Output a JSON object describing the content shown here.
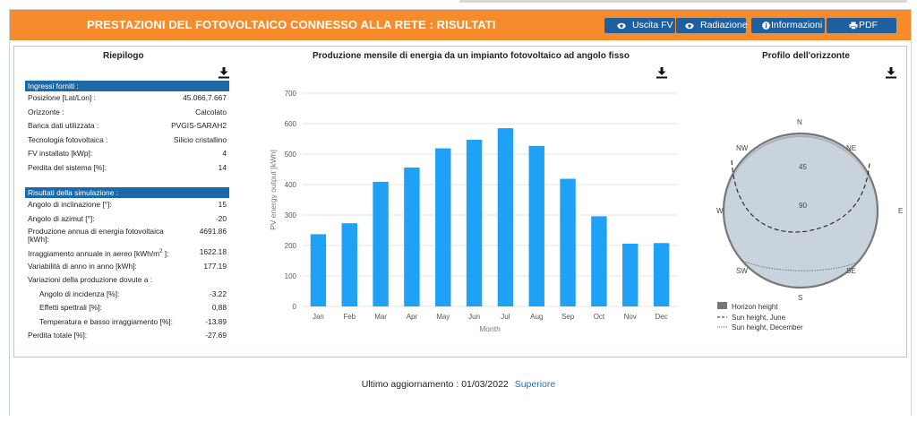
{
  "header": {
    "title": "PRESTAZIONI DEL FOTOVOLTAICO CONNESSO ALLA RETE : RISULTATI",
    "buttons": [
      {
        "label": "Uscita FV",
        "icon": "eye-icon"
      },
      {
        "label": "Radiazione",
        "icon": "eye-icon"
      },
      {
        "label": "Informazioni",
        "icon": "info-icon"
      },
      {
        "label": "PDF",
        "icon": "print-icon"
      }
    ]
  },
  "summary": {
    "title": "Riepilogo",
    "inputs_header": "Ingressi forniti :",
    "inputs": [
      {
        "label": "Posizione [Lat/Lon] :",
        "value": "45.066,7.667"
      },
      {
        "label": "Orizzonte :",
        "value": "Calcolato"
      },
      {
        "label": "Banca dati utilizzata :",
        "value": "PVGIS-SARAH2"
      },
      {
        "label": "Tecnologia fotovoltaica :",
        "value": "Silicio cristallino"
      },
      {
        "label": "FV installato [kWp]:",
        "value": "4"
      },
      {
        "label": "Perdita del sistema [%]:",
        "value": "14"
      }
    ],
    "results_header": "Risultati della simulazione :",
    "results": {
      "tilt": {
        "label": "Angolo di inclinazione [°]:",
        "value": "15"
      },
      "azimuth": {
        "label": "Angolo di azimut [°]:",
        "value": "-20"
      },
      "annual_production": {
        "label": "Produzione annua di energia fotovoltaica [kWh]:",
        "value": "4691.86"
      },
      "irradiation": {
        "label": "Irraggiamento annuale in aereo [kWh/m",
        "sup": "2",
        "label_end": " ]:",
        "value": "1622.18"
      },
      "variability": {
        "label": "Variabilità di anno in anno [kWh]:",
        "value": "177.19"
      },
      "variations_label": "Variazioni della produzione dovute a :",
      "incidence": {
        "label": "Angolo di incidenza [%]:",
        "value": "-3.22"
      },
      "spectral": {
        "label": "Effetti spettrali [%]:",
        "value": "0,88"
      },
      "temperature": {
        "label": "Temperatura e basso irraggiamento [%]:",
        "value": "-13.89"
      },
      "total_loss": {
        "label": "Perdita totale [%]:",
        "value": "-27.69"
      }
    }
  },
  "monthly_chart": {
    "title": "Produzione mensile di energia da un impianto fotovoltaico ad angolo fisso"
  },
  "horizon": {
    "title": "Profilo dell'orizzonte",
    "directions": {
      "n": "N",
      "ne": "NE",
      "e": "E",
      "se": "SE",
      "s": "S",
      "sw": "SW",
      "w": "W",
      "nw": "NW"
    },
    "ring_labels": {
      "inner": "90",
      "outer": "45"
    },
    "legend": [
      "Horizon height",
      "Sun height, June",
      "Sun height, December"
    ],
    "colors": {
      "disc": "#c9d3dd",
      "rim": "#7a7a7a",
      "june": "#222222",
      "december": "#666666"
    }
  },
  "chart_data": {
    "type": "bar",
    "title": "",
    "categories": [
      "Jan",
      "Feb",
      "Mar",
      "Apr",
      "May",
      "Jun",
      "Jul",
      "Aug",
      "Sep",
      "Oct",
      "Nov",
      "Dec"
    ],
    "values": [
      237,
      273,
      409,
      456,
      519,
      547,
      585,
      527,
      419,
      296,
      206,
      208
    ],
    "xlabel": "Month",
    "ylabel": "PV energy output [kWh]",
    "ylim": [
      0,
      700
    ],
    "yticks": [
      0,
      100,
      200,
      300,
      400,
      500,
      600,
      700
    ],
    "grid": true,
    "color": "#1fa1f5"
  },
  "footer": {
    "text": "Ultimo aggiornamento : 01/03/2022",
    "link": "Superiore"
  }
}
